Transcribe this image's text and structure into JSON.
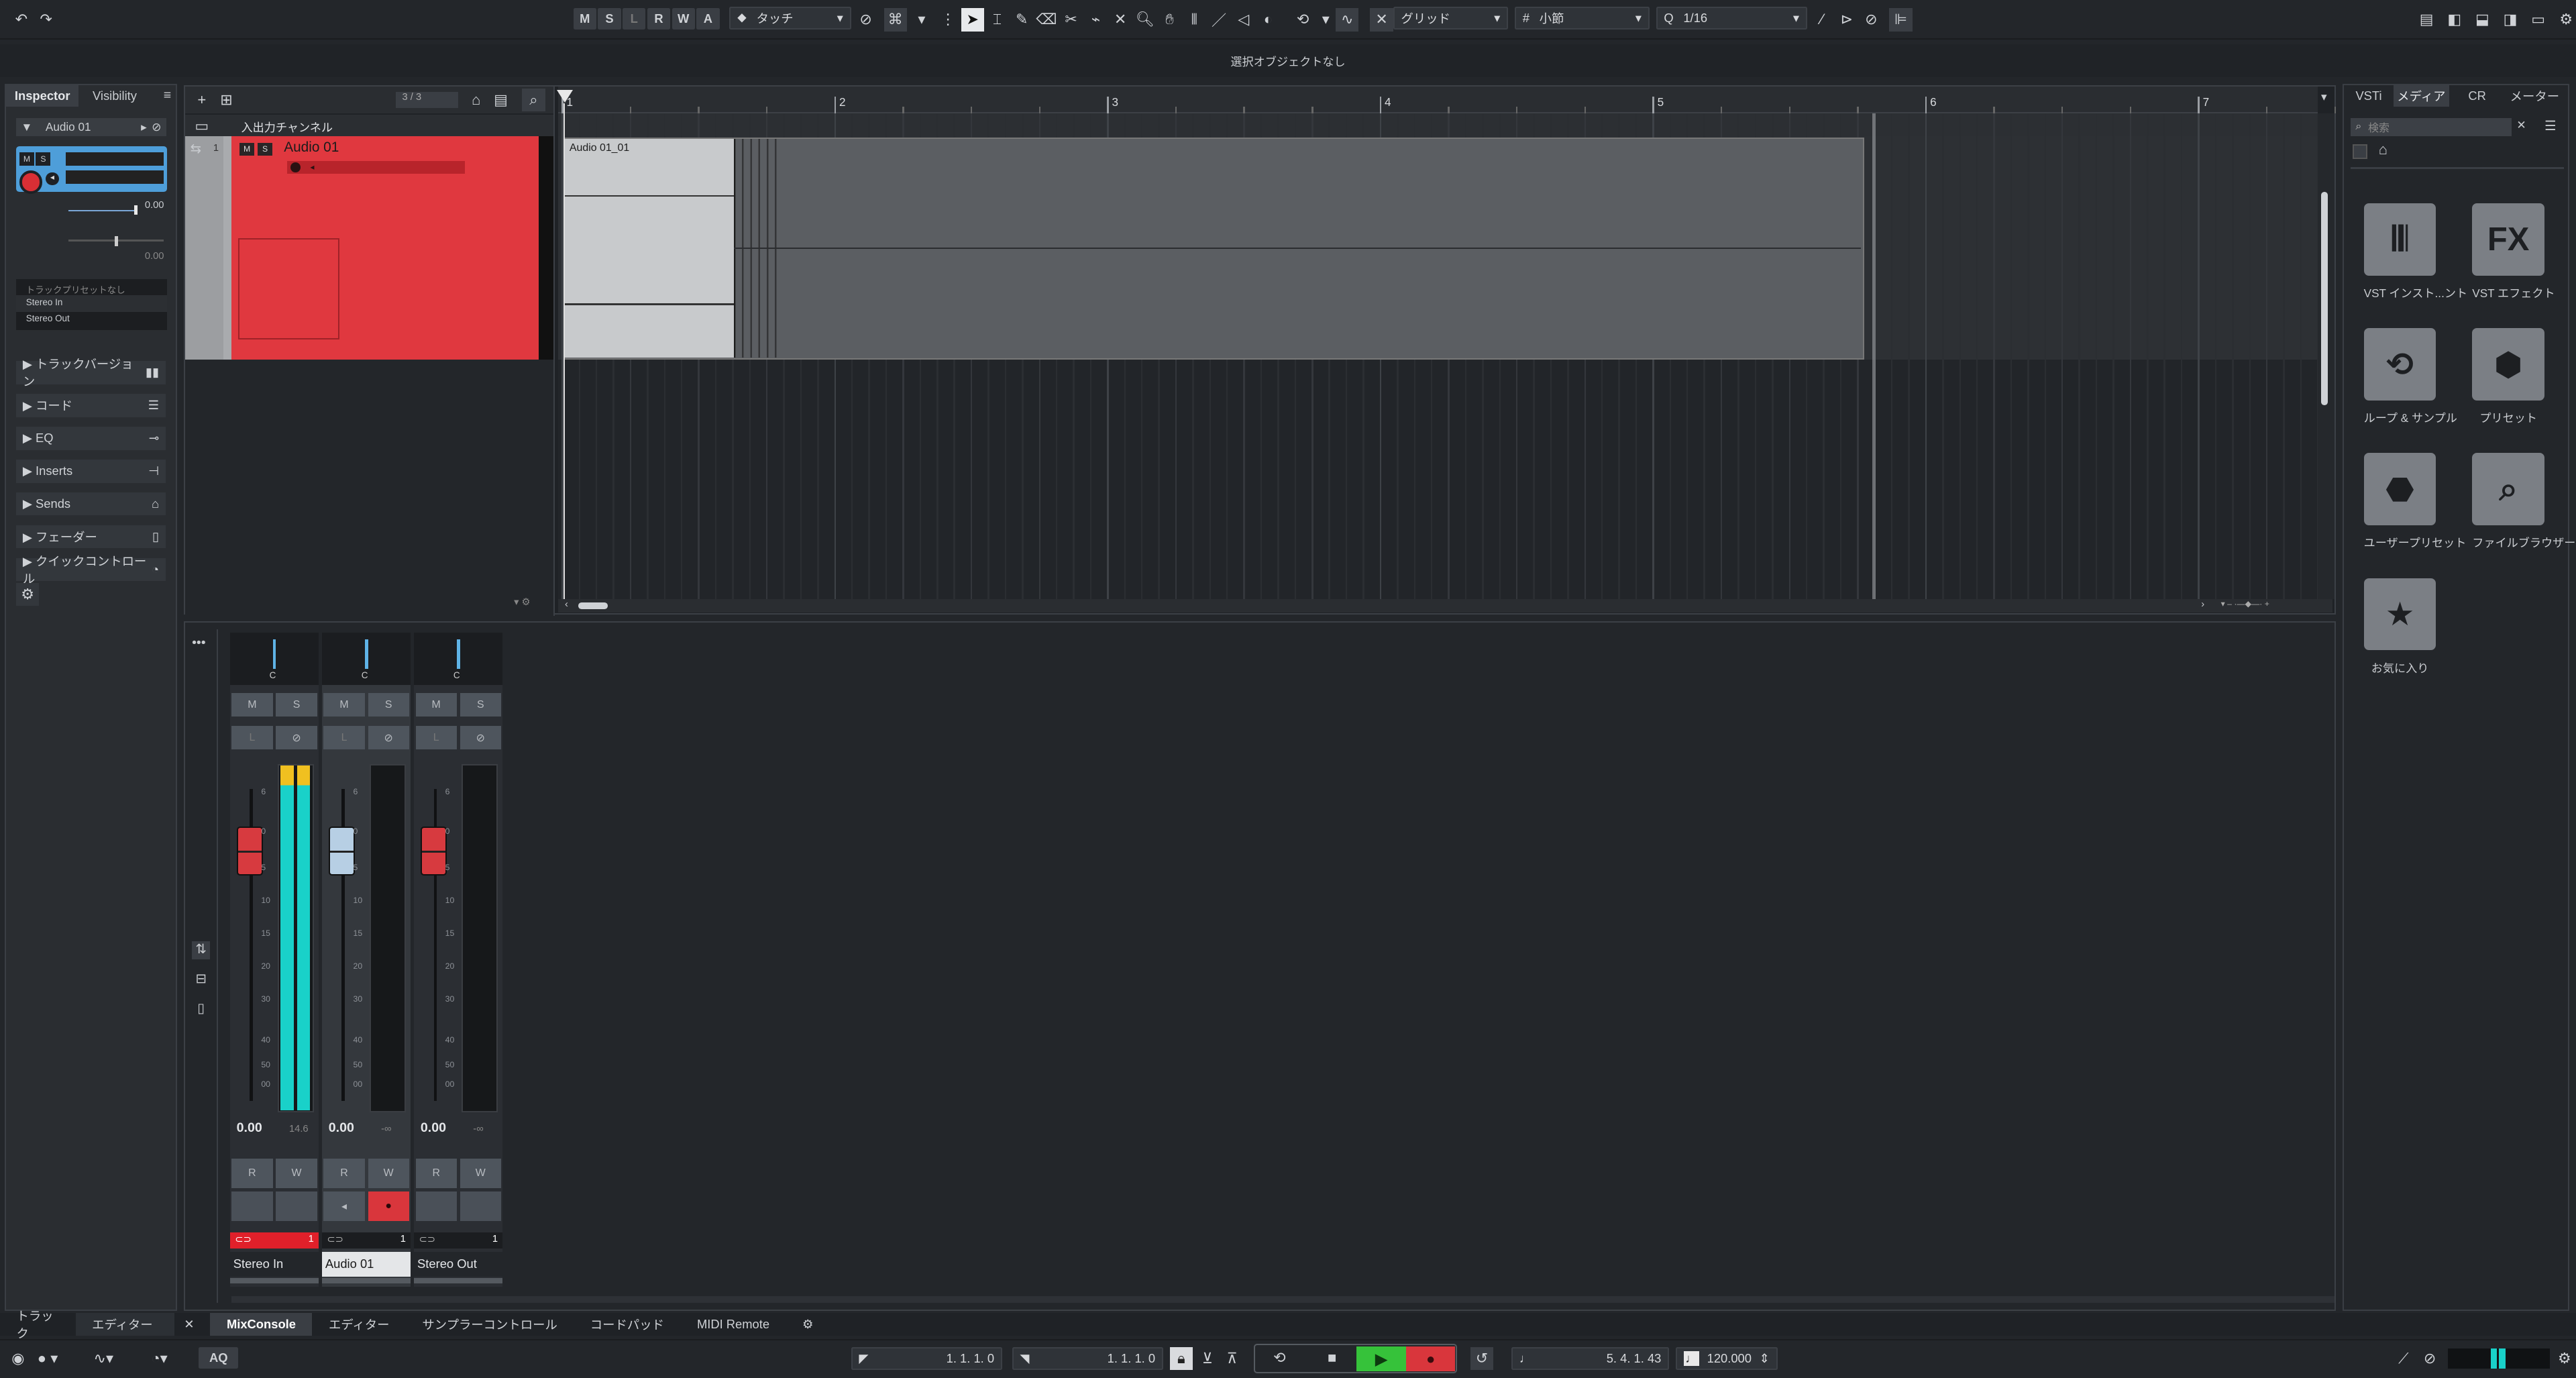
{
  "toolbar": {
    "undo_icon": "undo-icon",
    "redo_icon": "redo-icon",
    "mode_buttons": [
      "M",
      "S",
      "L",
      "R",
      "W",
      "A"
    ],
    "automation_mode": "タッチ",
    "snap_type": "グリッド",
    "grid_type": "小節",
    "quantize": "1/16"
  },
  "info_line": {
    "text": "選択オブジェクトなし"
  },
  "inspector": {
    "tabs": [
      "Inspector",
      "Visibility"
    ],
    "track_name": "Audio 01",
    "volume_value": "0.00",
    "pan_value": "0.00",
    "preset_label": "トラックプリセットなし",
    "input_routing": "Stereo In",
    "output_routing": "Stereo Out",
    "sections": [
      "トラックバージョン",
      "コード",
      "EQ",
      "Inserts",
      "Sends",
      "フェーダー",
      "クイックコントロール"
    ]
  },
  "project": {
    "track_count": "3 / 3",
    "folder_name": "入出力チャンネル",
    "track_number": "1",
    "track_name": "Audio 01",
    "event_name": "Audio 01_01",
    "ruler_marks": [
      "1",
      "2",
      "3",
      "4",
      "5",
      "6",
      "7"
    ]
  },
  "media": {
    "tabs": [
      "VSTi",
      "メディア",
      "CR",
      "メーター"
    ],
    "search_placeholder": "検索",
    "tiles": [
      {
        "label": "VST インスト...ント",
        "icon": "piano-keys-icon"
      },
      {
        "label": "VST エフェクト",
        "icon": "FX"
      },
      {
        "label": "ループ & サンプル",
        "icon": "loop-icon"
      },
      {
        "label": "プリセット",
        "icon": "preset-hexagons-icon"
      },
      {
        "label": "ユーザープリセット",
        "icon": "user-preset-icon"
      },
      {
        "label": "ファイルブラウザー",
        "icon": "file-browser-icon"
      },
      {
        "label": "お気に入り",
        "icon": "star-icon"
      }
    ]
  },
  "mixer": {
    "channels": [
      {
        "name": "Stereo In",
        "pan": "C",
        "volume": "0.00",
        "peak": "14.6",
        "number": "1",
        "color": "#e0202a"
      },
      {
        "name": "Audio 01",
        "pan": "C",
        "volume": "0.00",
        "peak": "-∞",
        "number": "1",
        "color": "#ffffff"
      },
      {
        "name": "Stereo Out",
        "pan": "C",
        "volume": "0.00",
        "peak": "-∞",
        "number": "1",
        "color": "#1b1d20"
      }
    ],
    "scale_marks": [
      "6",
      "0",
      "5",
      "10",
      "15",
      "20",
      "30",
      "40",
      "50",
      "00"
    ],
    "button_m": "M",
    "button_s": "S",
    "button_r": "R",
    "button_w": "W"
  },
  "bottom_tabs": {
    "left": [
      "トラック",
      "エディター"
    ],
    "center": [
      "MixConsole",
      "エディター",
      "サンプラーコントロール",
      "コードパッド",
      "MIDI Remote"
    ]
  },
  "transport": {
    "aq_label": "AQ",
    "left_locator": "1. 1. 1.   0",
    "right_locator": "1. 1. 1.   0",
    "position": "5. 4. 1. 43",
    "tempo": "120.000"
  },
  "colors": {
    "track_red": "#e0383f",
    "play_green": "#36c23a",
    "record_red": "#d9363c",
    "meter_cyan": "#19d1c9",
    "meter_yellow": "#f0c020"
  }
}
